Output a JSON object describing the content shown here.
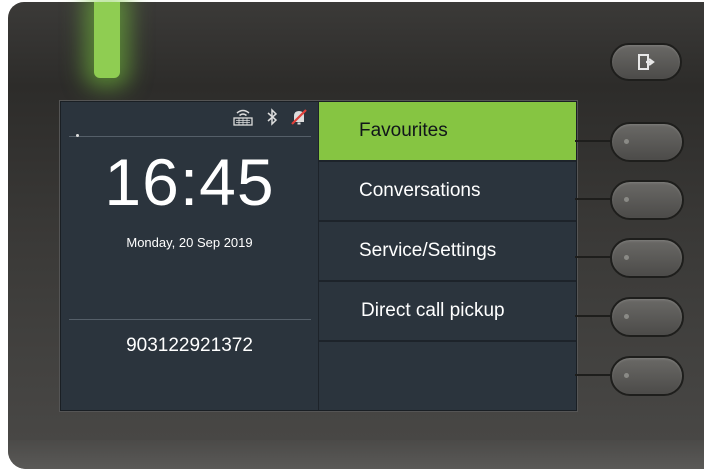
{
  "screen": {
    "clock": "16:45",
    "date": "Monday, 20 Sep 2019",
    "phone_number": "903122921372",
    "status_icons": [
      "network-icon",
      "bluetooth-icon",
      "ringer-off-icon"
    ]
  },
  "menu": {
    "items": [
      {
        "label": "Favourites",
        "selected": true
      },
      {
        "label": "Conversations",
        "selected": false
      },
      {
        "label": "Service/Settings",
        "selected": false
      },
      {
        "label": "Direct call pickup",
        "selected": false
      },
      {
        "label": "",
        "selected": false
      }
    ]
  },
  "hardware": {
    "led_color": "#8fcd52",
    "accent_color": "#86c542",
    "exit_key_icon": "exit-icon",
    "side_keys": 5
  }
}
